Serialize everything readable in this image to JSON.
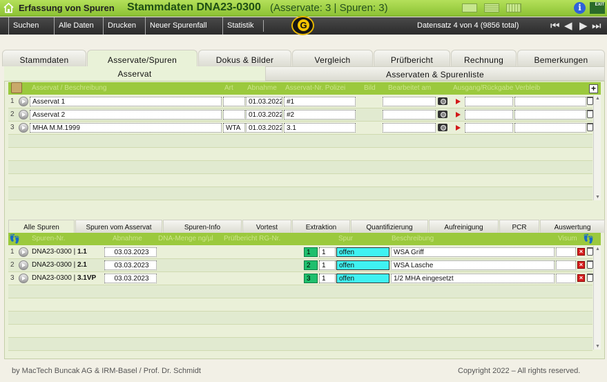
{
  "title": {
    "app": "Erfassung von Spuren",
    "record": "Stammdaten DNA23-0300",
    "counts": "(Asservate: 3  |  Spuren: 3)",
    "exit": "EXIT",
    "info": "i"
  },
  "toolbar": {
    "items": [
      "Suchen",
      "Alle Daten",
      "Drucken",
      "Neuer Spurenfall",
      "Statistik"
    ],
    "record_info": "Datensatz 4 von 4 (9856 total)",
    "logo": "G"
  },
  "main_tabs": [
    "Stammdaten",
    "Asservate/Spuren",
    "Dokus & Bilder",
    "Vergleich",
    "Prüfbericht",
    "Rechnung",
    "Bemerkungen"
  ],
  "sub_tabs": [
    "Asservat",
    "Asservaten & Spurenliste"
  ],
  "asservat_grid": {
    "headers": [
      "Asservat / Beschreibung",
      "Art",
      "Abnahme",
      "Asservat-Nr. Polizei",
      "Bild",
      "Bearbeitet am",
      "Ausgang/Rückgabe Verbleib"
    ],
    "rows": [
      {
        "n": "1",
        "beschreibung": "Asservat 1",
        "art": "",
        "abnahme": "01.03.2022",
        "nr": "#1"
      },
      {
        "n": "2",
        "beschreibung": "Asservat 2",
        "art": "",
        "abnahme": "01.03.2022",
        "nr": "#2"
      },
      {
        "n": "3",
        "beschreibung": "MHA M.M.1999",
        "art": "WTA",
        "abnahme": "01.03.2022",
        "nr": "3.1"
      }
    ]
  },
  "spuren_tabs": [
    "Alle Spuren",
    "Spuren vom Asservat",
    "Spuren-Info",
    "Vortest",
    "Extraktion",
    "Quantifizierung",
    "Aufreinigung",
    "PCR",
    "Auswertung"
  ],
  "spuren_grid": {
    "headers": [
      "Spuren-Nr.",
      "Abnahme",
      "DNA-Menge ng/µl",
      "Prüfbericht RG-Nr.",
      "Spur",
      "Beschreibung",
      "Visum"
    ],
    "rows": [
      {
        "n": "1",
        "nr_prefix": "DNA23-0300 | ",
        "nr_suffix": "1.1",
        "abnahme": "03.03.2023",
        "spur_a": "1",
        "spur_b": "1",
        "status": "offen",
        "beschreibung": "WSA Griff"
      },
      {
        "n": "2",
        "nr_prefix": "DNA23-0300 | ",
        "nr_suffix": "2.1",
        "abnahme": "03.03.2023",
        "spur_a": "2",
        "spur_b": "1",
        "status": "offen",
        "beschreibung": "WSA Lasche"
      },
      {
        "n": "3",
        "nr_prefix": "DNA23-0300 | ",
        "nr_suffix": "3.1VP",
        "abnahme": "03.03.2023",
        "spur_a": "3",
        "spur_b": "1",
        "status": "offen",
        "beschreibung": "1/2 MHA eingesetzt"
      }
    ]
  },
  "footer": {
    "left": "by MacTech Buncak AG & IRM-Basel / Prof. Dr. Schmidt",
    "right": "Copyright 2022 – All rights reserved."
  }
}
